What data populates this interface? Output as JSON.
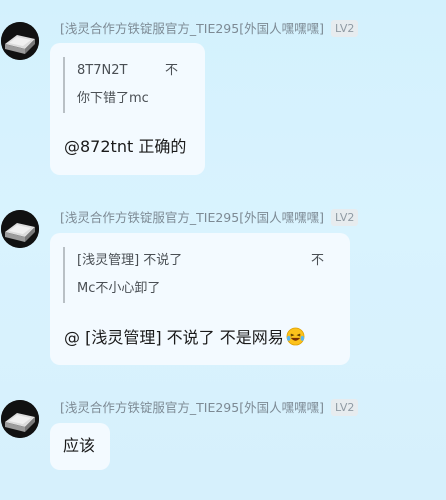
{
  "sender_name": "[浅灵合作方铁锭服官方_TIE295[外国人嘿嘿嘿]",
  "level_badge": "LV2",
  "messages": [
    {
      "quote_author": "8T7N2T",
      "quote_revoke": "不",
      "quote_text": "你下错了mc",
      "text": "@872tnt 正确的"
    },
    {
      "quote_author": "[浅灵管理]  不说了",
      "quote_revoke": "不",
      "quote_text": "Mc不小心卸了",
      "text": "@ [浅灵管理]  不说了 不是网易",
      "emoji": "laughing-tears-emoji"
    },
    {
      "text": "应该"
    }
  ]
}
